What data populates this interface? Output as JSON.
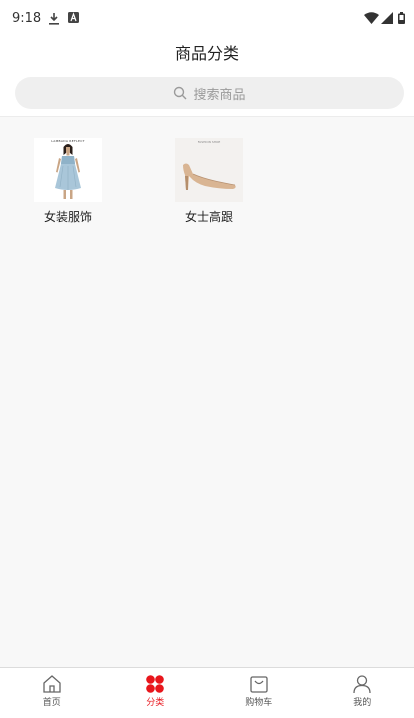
{
  "status_bar": {
    "time": "9:18"
  },
  "header": {
    "title": "商品分类"
  },
  "search": {
    "placeholder": "搜索商品"
  },
  "categories": [
    {
      "label": "女装服饰",
      "thumb_brand_text": "LAMBADA REFLECT"
    },
    {
      "label": "女士高跟",
      "thumb_brand_text": "FASHION SHOE"
    }
  ],
  "tabbar": {
    "active_color": "#e8161c",
    "items": [
      {
        "label": "首页",
        "icon": "home-icon"
      },
      {
        "label": "分类",
        "icon": "category-icon"
      },
      {
        "label": "购物车",
        "icon": "cart-icon"
      },
      {
        "label": "我的",
        "icon": "user-icon"
      }
    ]
  }
}
